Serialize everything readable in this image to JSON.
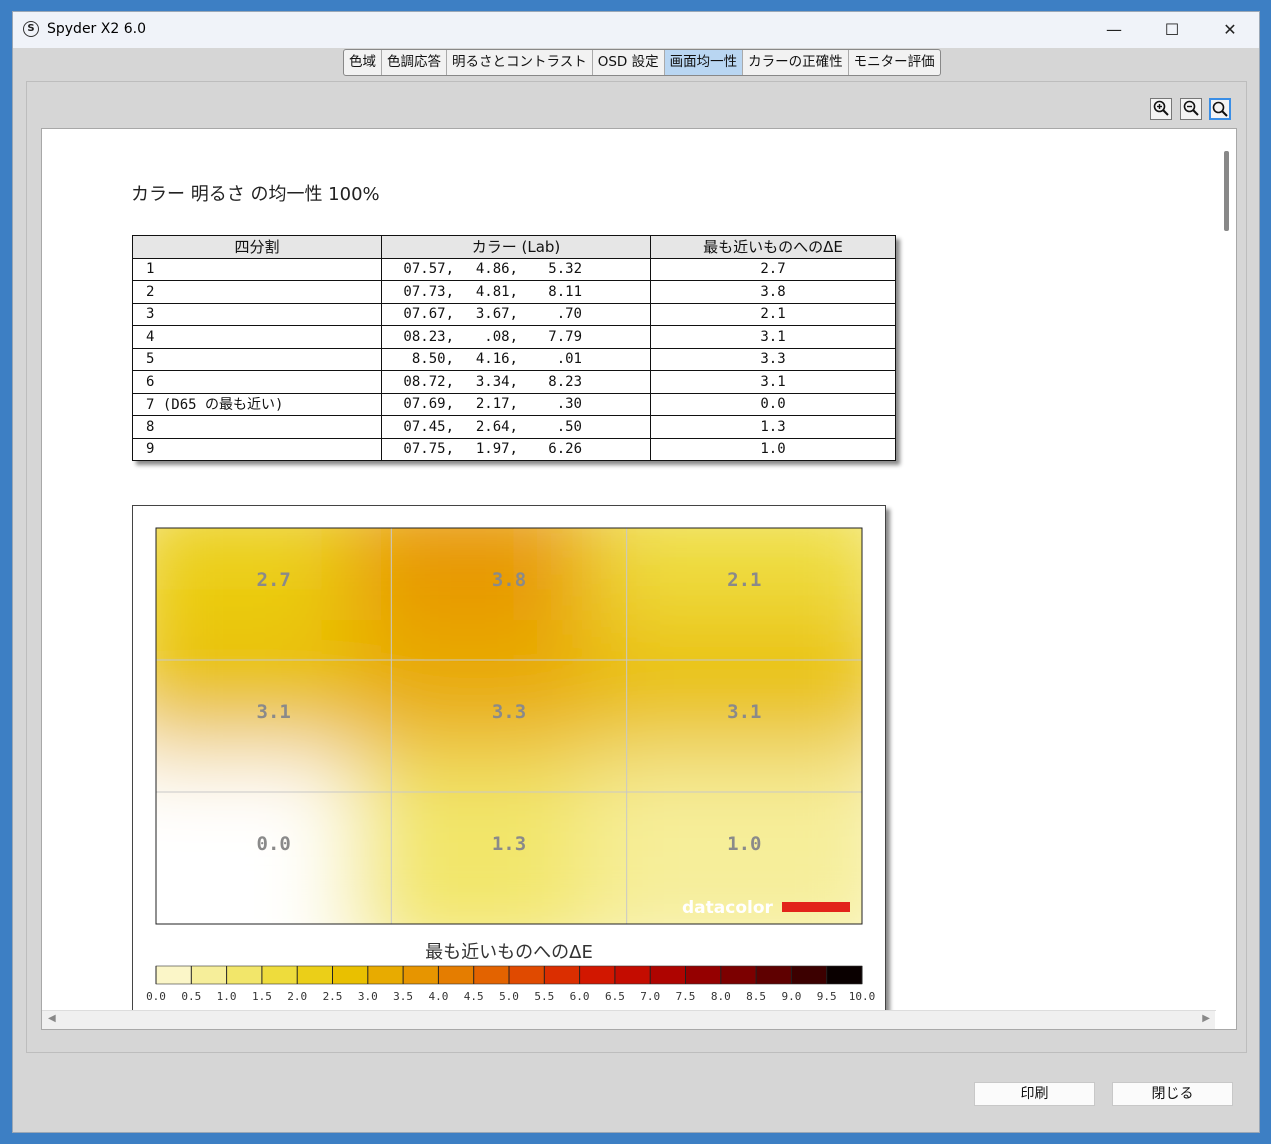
{
  "window": {
    "title": "Spyder X2 6.0",
    "app_icon": "S",
    "minimize": "—",
    "maximize": "☐",
    "close": "✕"
  },
  "tabs": [
    {
      "label": "色域",
      "active": false
    },
    {
      "label": "色調応答",
      "active": false
    },
    {
      "label": "明るさとコントラスト",
      "active": false
    },
    {
      "label": "OSD 設定",
      "active": false
    },
    {
      "label": "画面均一性",
      "active": true
    },
    {
      "label": "カラーの正確性",
      "active": false
    },
    {
      "label": "モニター評価",
      "active": false
    }
  ],
  "zoom": {
    "zoom_in_icon": "zoom-in-icon",
    "zoom_out_icon": "zoom-out-icon",
    "zoom_fit_icon": "zoom-fit-icon"
  },
  "report": {
    "title": "カラー 明るさ の均一性 100%",
    "table": {
      "headers": [
        "四分割",
        "カラー (Lab)",
        "最も近いものへのΔE"
      ],
      "rows": [
        {
          "quad": "1",
          "l": "07.57,",
          "a": "4.86,",
          "b": "5.32",
          "de": "2.7"
        },
        {
          "quad": "2",
          "l": "07.73,",
          "a": "4.81,",
          "b": "8.11",
          "de": "3.8"
        },
        {
          "quad": "3",
          "l": "07.67,",
          "a": "3.67,",
          "b": ".70",
          "de": "2.1"
        },
        {
          "quad": "4",
          "l": "08.23,",
          "a": ".08,",
          "b": "7.79",
          "de": "3.1"
        },
        {
          "quad": "5",
          "l": "8.50,",
          "a": "4.16,",
          "b": ".01",
          "de": "3.3"
        },
        {
          "quad": "6",
          "l": "08.72,",
          "a": "3.34,",
          "b": "8.23",
          "de": "3.1"
        },
        {
          "quad": "7 (D65 の最も近い)",
          "l": "07.69,",
          "a": "2.17,",
          "b": ".30",
          "de": "0.0"
        },
        {
          "quad": "8",
          "l": "07.45,",
          "a": "2.64,",
          "b": ".50",
          "de": "1.3"
        },
        {
          "quad": "9",
          "l": "07.75,",
          "a": "1.97,",
          "b": "6.26",
          "de": "1.0"
        }
      ]
    }
  },
  "chart_data": {
    "type": "heatmap",
    "grid": [
      [
        2.7,
        3.8,
        2.1
      ],
      [
        3.1,
        3.3,
        3.1
      ],
      [
        0.0,
        1.3,
        1.0
      ]
    ],
    "cell_labels": [
      [
        "2.7",
        "3.8",
        "2.1"
      ],
      [
        "3.1",
        "3.3",
        "3.1"
      ],
      [
        "0.0",
        "1.3",
        "1.0"
      ]
    ],
    "colorbar_title": "最も近いものへのΔE",
    "colorbar_ticks": [
      "0.0",
      "0.5",
      "1.0",
      "1.5",
      "2.0",
      "2.5",
      "3.0",
      "3.5",
      "4.0",
      "4.5",
      "5.0",
      "5.5",
      "6.0",
      "6.5",
      "7.0",
      "7.5",
      "8.0",
      "8.5",
      "9.0",
      "9.5",
      "10.0"
    ],
    "colorbar_range": [
      0,
      10
    ],
    "colorbar_colors": [
      "#ffffff",
      "#fbf6c8",
      "#f6ee9a",
      "#f2e66a",
      "#eedc3c",
      "#ebcf18",
      "#e9c000",
      "#e8ab00",
      "#e79500",
      "#e57d00",
      "#e36300",
      "#e04a00",
      "#db2e00",
      "#d21700",
      "#c40c00",
      "#ae0400",
      "#950000",
      "#7c0000",
      "#5f0000",
      "#3c0000",
      "#0a0000"
    ],
    "watermark": "datacolor",
    "brand_color": "#e2231a"
  },
  "buttons": {
    "print": "印刷",
    "close": "閉じる"
  }
}
